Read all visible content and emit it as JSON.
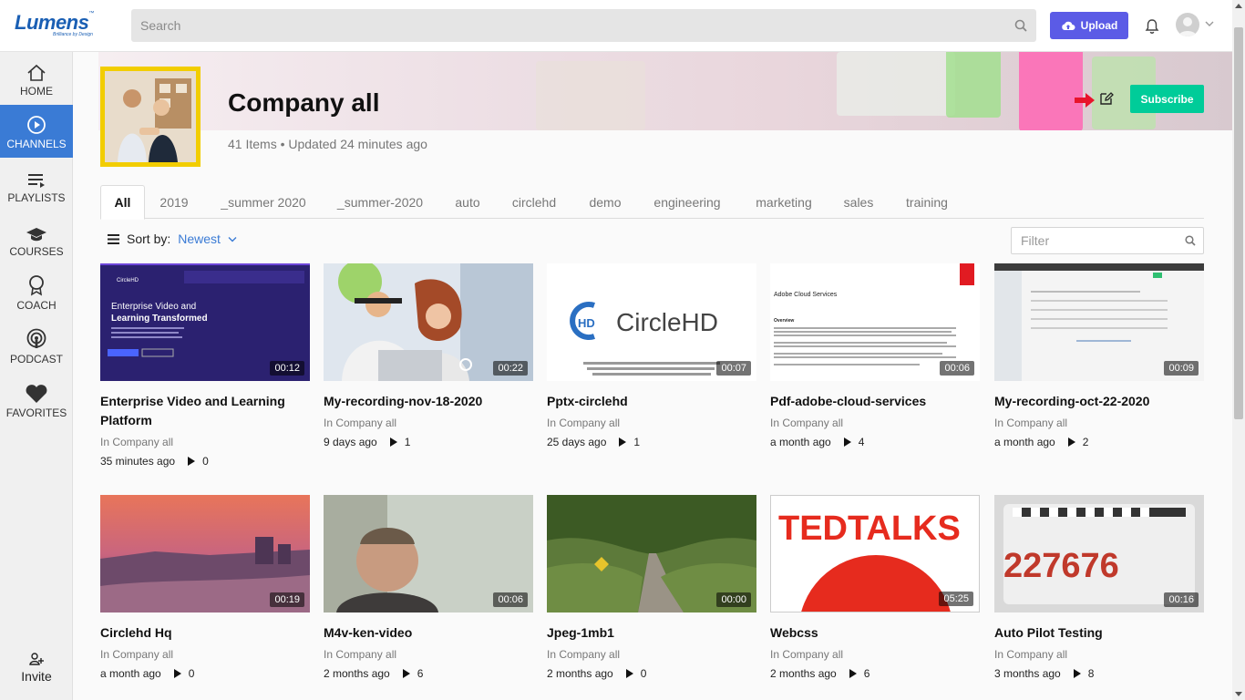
{
  "brand": {
    "name": "Lumens",
    "tagline": "Brilliance by Design"
  },
  "search": {
    "placeholder": "Search"
  },
  "header": {
    "upload_label": "Upload"
  },
  "sidebar": {
    "items": [
      {
        "label": "HOME",
        "icon": "home-icon"
      },
      {
        "label": "CHANNELS",
        "icon": "play-circle-icon",
        "active": true
      },
      {
        "label": "PLAYLISTS",
        "icon": "playlist-icon"
      },
      {
        "label": "COURSES",
        "icon": "graduation-cap-icon"
      },
      {
        "label": "COACH",
        "icon": "coach-badge-icon"
      },
      {
        "label": "PODCAST",
        "icon": "podcast-icon"
      },
      {
        "label": "FAVORITES",
        "icon": "heart-icon"
      }
    ],
    "invite_label": "Invite"
  },
  "channel": {
    "title": "Company all",
    "meta": "41 Items • Updated 24 minutes ago",
    "subscribe_label": "Subscribe"
  },
  "tabs": [
    "All",
    "2019",
    "_summer 2020",
    "_summer-2020",
    "auto",
    "circlehd",
    "demo",
    "engineering",
    "marketing",
    "sales",
    "training"
  ],
  "sort": {
    "label": "Sort by:",
    "value": "Newest"
  },
  "filter": {
    "placeholder": "Filter"
  },
  "videos": [
    {
      "title": "Enterprise Video and Learning Platform",
      "channel": "In Company all",
      "age": "35 minutes ago",
      "views": "0",
      "duration": "00:12"
    },
    {
      "title": "My-recording-nov-18-2020",
      "channel": "In Company all",
      "age": "9 days ago",
      "views": "1",
      "duration": "00:22"
    },
    {
      "title": "Pptx-circlehd",
      "channel": "In Company all",
      "age": "25 days ago",
      "views": "1",
      "duration": "00:07"
    },
    {
      "title": "Pdf-adobe-cloud-services",
      "channel": "In Company all",
      "age": "a month ago",
      "views": "4",
      "duration": "00:06"
    },
    {
      "title": "My-recording-oct-22-2020",
      "channel": "In Company all",
      "age": "a month ago",
      "views": "2",
      "duration": "00:09"
    },
    {
      "title": "Circlehd Hq",
      "channel": "In Company all",
      "age": "a month ago",
      "views": "0",
      "duration": "00:19"
    },
    {
      "title": "M4v-ken-video",
      "channel": "In Company all",
      "age": "2 months ago",
      "views": "6",
      "duration": "00:06"
    },
    {
      "title": "Jpeg-1mb1",
      "channel": "In Company all",
      "age": "2 months ago",
      "views": "0",
      "duration": "00:00"
    },
    {
      "title": "Webcss",
      "channel": "In Company all",
      "age": "2 months ago",
      "views": "6",
      "duration": "05:25"
    },
    {
      "title": "Auto Pilot Testing",
      "channel": "In Company all",
      "age": "3 months ago",
      "views": "8",
      "duration": "00:16"
    }
  ],
  "thumbnail_text": {
    "v0_brand": "CircleHD",
    "v0_headline_1": "Enterprise Video and",
    "v0_headline_2": "Learning Transformed",
    "v2_logo": "CircleHD",
    "v2_logo_mark": "HD",
    "v3_heading": "Adobe Cloud Services",
    "v3_subheading": "Overview",
    "v8_logo": "TEDTALKS",
    "v9_plate": "227676"
  },
  "colors": {
    "accent": "#3a7bd5",
    "upload": "#5b5be6",
    "subscribe": "#00cc99",
    "channel_thumb_border": "#f2cd00"
  }
}
